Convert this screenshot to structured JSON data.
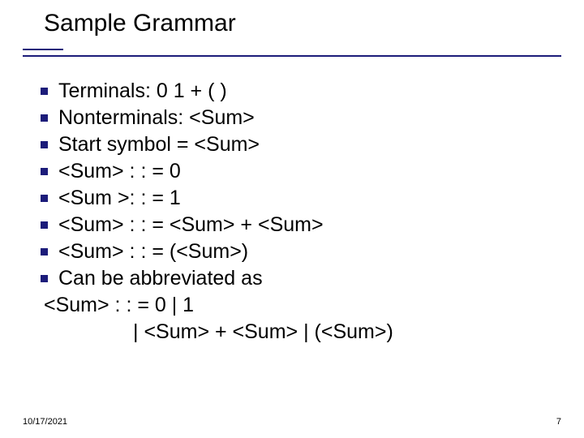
{
  "title": "Sample Grammar",
  "group1": {
    "b1": "Terminals: 0 1 + ( )",
    "b2": "Nonterminals: <Sum>",
    "b3": "Start symbol = <Sum>"
  },
  "group2": {
    "b1": "<Sum> : : = 0",
    "b2": "<Sum >: : = 1",
    "b3": "<Sum> : : = <Sum> + <Sum>",
    "b4": "<Sum> : : = (<Sum>)",
    "b5": "Can be abbreviated as",
    "line1": "<Sum> : : = 0 | 1",
    "line2": "| <Sum> + <Sum> | (<Sum>)"
  },
  "footer": {
    "date": "10/17/2021",
    "page": "7"
  },
  "colors": {
    "accent": "#1c1c7a"
  }
}
